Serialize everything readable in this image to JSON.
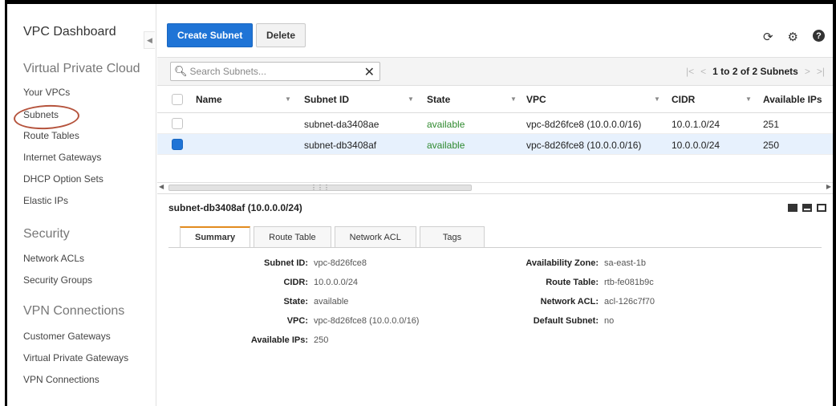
{
  "sidebar": {
    "title": "VPC Dashboard",
    "sections": [
      {
        "title": "Virtual Private Cloud",
        "items": [
          "Your VPCs",
          "Subnets",
          "Route Tables",
          "Internet Gateways",
          "DHCP Option Sets",
          "Elastic IPs"
        ]
      },
      {
        "title": "Security",
        "items": [
          "Network ACLs",
          "Security Groups"
        ]
      },
      {
        "title": "VPN Connections",
        "items": [
          "Customer Gateways",
          "Virtual Private Gateways",
          "VPN Connections"
        ]
      }
    ],
    "collapse_icon": "chevron-left-icon"
  },
  "toolbar": {
    "create_label": "Create Subnet",
    "delete_label": "Delete",
    "icons": [
      "refresh-icon",
      "gear-icon",
      "help-icon"
    ]
  },
  "search": {
    "placeholder": "Search Subnets...",
    "value": "",
    "clear_glyph": "✕"
  },
  "pager": {
    "text": "1 to 2 of 2 Subnets"
  },
  "table": {
    "columns": [
      "Name",
      "Subnet ID",
      "State",
      "VPC",
      "CIDR",
      "Available IPs"
    ],
    "rows": [
      {
        "name": "",
        "subnet_id": "subnet-da3408ae",
        "state": "available",
        "vpc": "vpc-8d26fce8 (10.0.0.0/16)",
        "cidr": "10.0.1.0/24",
        "ips": "251",
        "selected": false
      },
      {
        "name": "",
        "subnet_id": "subnet-db3408af",
        "state": "available",
        "vpc": "vpc-8d26fce8 (10.0.0.0/16)",
        "cidr": "10.0.0.0/24",
        "ips": "250",
        "selected": true
      }
    ]
  },
  "detail": {
    "title": "subnet-db3408af (10.0.0.0/24)",
    "tabs": [
      "Summary",
      "Route Table",
      "Network ACL",
      "Tags"
    ],
    "left": [
      {
        "k": "Subnet ID:",
        "v": "vpc-8d26fce8"
      },
      {
        "k": "CIDR:",
        "v": "10.0.0.0/24"
      },
      {
        "k": "State:",
        "v": "available"
      },
      {
        "k": "VPC:",
        "v": "vpc-8d26fce8 (10.0.0.0/16)"
      },
      {
        "k": "Available IPs:",
        "v": "250"
      }
    ],
    "right": [
      {
        "k": "Availability Zone:",
        "v": "sa-east-1b"
      },
      {
        "k": "Route Table:",
        "v": "rtb-fe081b9c"
      },
      {
        "k": "Network ACL:",
        "v": "acl-126c7f70"
      },
      {
        "k": "Default Subnet:",
        "v": "no"
      }
    ]
  },
  "colors": {
    "primary": "#1f74d6",
    "available": "#2f8a2f",
    "active_tab": "#e28b1e",
    "highlight": "#b5533c"
  }
}
